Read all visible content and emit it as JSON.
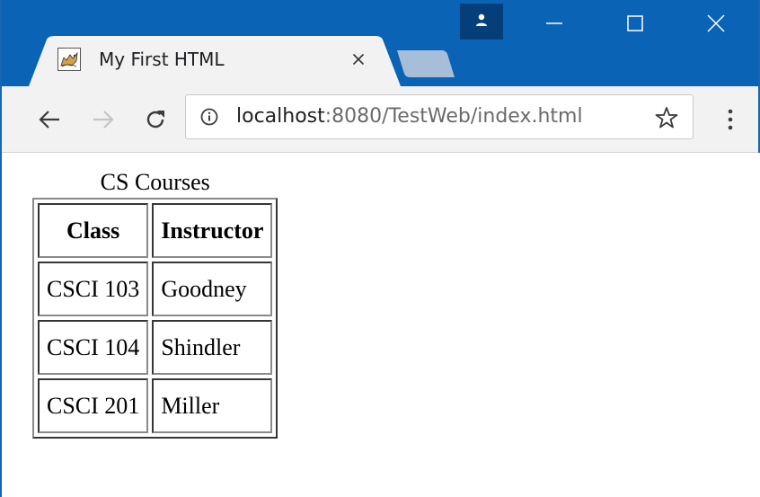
{
  "window": {
    "profile_icon": "person-icon",
    "minimize_icon": "minimize-icon",
    "maximize_icon": "maximize-icon",
    "close_icon": "close-icon"
  },
  "tab": {
    "title": "My First HTML",
    "favicon": "tomcat-favicon-icon",
    "close_glyph": "✕"
  },
  "toolbar": {
    "url_host": "localhost",
    "url_rest": ":8080/TestWeb/index.html",
    "star_glyph": "☆"
  },
  "page": {
    "table": {
      "caption": "CS Courses",
      "headers": [
        "Class",
        "Instructor"
      ],
      "rows": [
        [
          "CSCI 103",
          "Goodney"
        ],
        [
          "CSCI 104",
          "Shindler"
        ],
        [
          "CSCI 201",
          "Miller"
        ]
      ]
    }
  },
  "colors": {
    "titlebar": "#0b63b5",
    "toolbar": "#f2f2f2",
    "newtab": "#a7bed8"
  }
}
